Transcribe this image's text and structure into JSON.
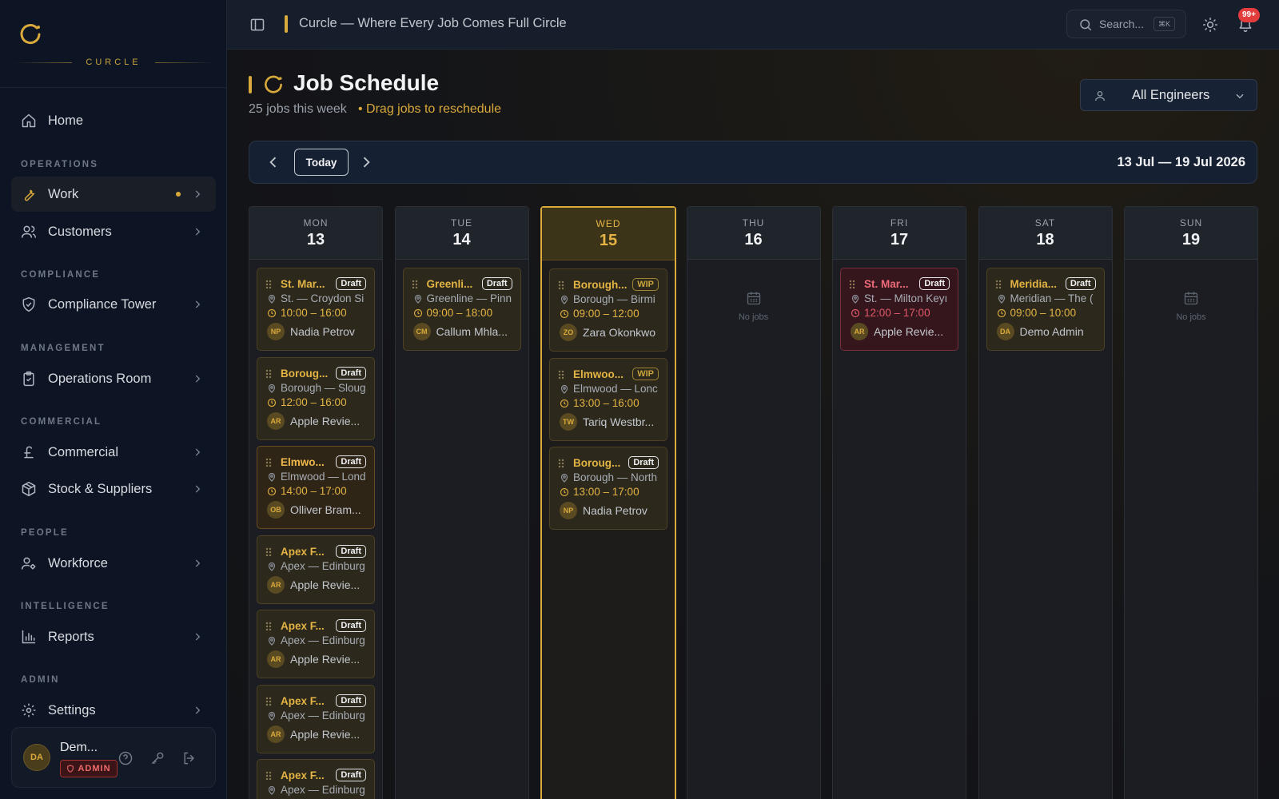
{
  "brand": {
    "name": "CURCLE"
  },
  "sidebar": {
    "home": "Home",
    "sections": [
      {
        "label": "OPERATIONS",
        "items": [
          "Work",
          "Customers"
        ]
      },
      {
        "label": "COMPLIANCE",
        "items": [
          "Compliance Tower"
        ]
      },
      {
        "label": "MANAGEMENT",
        "items": [
          "Operations Room"
        ]
      },
      {
        "label": "COMMERCIAL",
        "items": [
          "Commercial",
          "Stock & Suppliers"
        ]
      },
      {
        "label": "PEOPLE",
        "items": [
          "Workforce"
        ]
      },
      {
        "label": "INTELLIGENCE",
        "items": [
          "Reports"
        ]
      },
      {
        "label": "ADMIN",
        "items": [
          "Settings"
        ]
      }
    ],
    "user": {
      "initials": "DA",
      "name": "Dem...",
      "role": "ADMIN"
    }
  },
  "header": {
    "title": "Curcle — Where Every Job Comes Full Circle",
    "search_placeholder": "Search...",
    "search_shortcut": "⌘K",
    "notifications": "99+"
  },
  "page": {
    "title": "Job Schedule",
    "subtitle": "25 jobs this week",
    "hint": "• Drag jobs to reschedule",
    "engineer_filter": "All Engineers",
    "today_label": "Today",
    "date_range": "13 Jul — 19 Jul 2026",
    "no_jobs": "No jobs"
  },
  "days": [
    {
      "name": "MON",
      "num": "13",
      "jobs": [
        {
          "name": "St. Mar...",
          "status": "Draft",
          "location": "St. — Croydon Si",
          "time": "10:00 – 16:00",
          "initials": "NP",
          "engineer": "Nadia Petrov"
        },
        {
          "name": "Boroug...",
          "status": "Draft",
          "location": "Borough — Sloug",
          "time": "12:00 – 16:00",
          "initials": "AR",
          "engineer": "Apple Revie..."
        },
        {
          "name": "Elmwo...",
          "status": "Draft",
          "location": "Elmwood — Lond",
          "time": "14:00 – 17:00",
          "initials": "OB",
          "engineer": "Olliver Bram..."
        },
        {
          "name": "Apex F...",
          "status": "Draft",
          "location": "Apex — Edinburg",
          "time": "",
          "initials": "AR",
          "engineer": "Apple Revie..."
        },
        {
          "name": "Apex F...",
          "status": "Draft",
          "location": "Apex — Edinburg",
          "time": "",
          "initials": "AR",
          "engineer": "Apple Revie..."
        },
        {
          "name": "Apex F...",
          "status": "Draft",
          "location": "Apex — Edinburg",
          "time": "",
          "initials": "AR",
          "engineer": "Apple Revie..."
        },
        {
          "name": "Apex F...",
          "status": "Draft",
          "location": "Apex — Edinburg",
          "time": "",
          "initials": "",
          "engineer": ""
        }
      ]
    },
    {
      "name": "TUE",
      "num": "14",
      "jobs": [
        {
          "name": "Greenli...",
          "status": "Draft",
          "location": "Greenline — Pinn",
          "time": "09:00 – 18:00",
          "initials": "CM",
          "engineer": "Callum Mhla..."
        }
      ]
    },
    {
      "name": "WED",
      "num": "15",
      "jobs": [
        {
          "name": "Borough...",
          "status": "WIP",
          "location": "Borough — Birmi",
          "time": "09:00 – 12:00",
          "initials": "ZO",
          "engineer": "Zara Okonkwo"
        },
        {
          "name": "Elmwoo...",
          "status": "WIP",
          "location": "Elmwood — Lonc",
          "time": "13:00 – 16:00",
          "initials": "TW",
          "engineer": "Tariq Westbr..."
        },
        {
          "name": "Boroug...",
          "status": "Draft",
          "location": "Borough — North",
          "time": "13:00 – 17:00",
          "initials": "NP",
          "engineer": "Nadia Petrov"
        }
      ]
    },
    {
      "name": "THU",
      "num": "16",
      "jobs": []
    },
    {
      "name": "FRI",
      "num": "17",
      "jobs": [
        {
          "name": "St. Mar...",
          "status": "Draft",
          "location": "St. — Milton Keyı",
          "time": "12:00 – 17:00",
          "initials": "AR",
          "engineer": "Apple Revie..."
        }
      ]
    },
    {
      "name": "SAT",
      "num": "18",
      "jobs": [
        {
          "name": "Meridia...",
          "status": "Draft",
          "location": "Meridian — The (",
          "time": "09:00 – 10:00",
          "initials": "DA",
          "engineer": "Demo Admin"
        }
      ]
    },
    {
      "name": "SUN",
      "num": "19",
      "jobs": []
    }
  ],
  "colors": {
    "accent": "#d9a93b",
    "danger": "#e23c3c",
    "sidebar_bg": "#0d1525"
  }
}
